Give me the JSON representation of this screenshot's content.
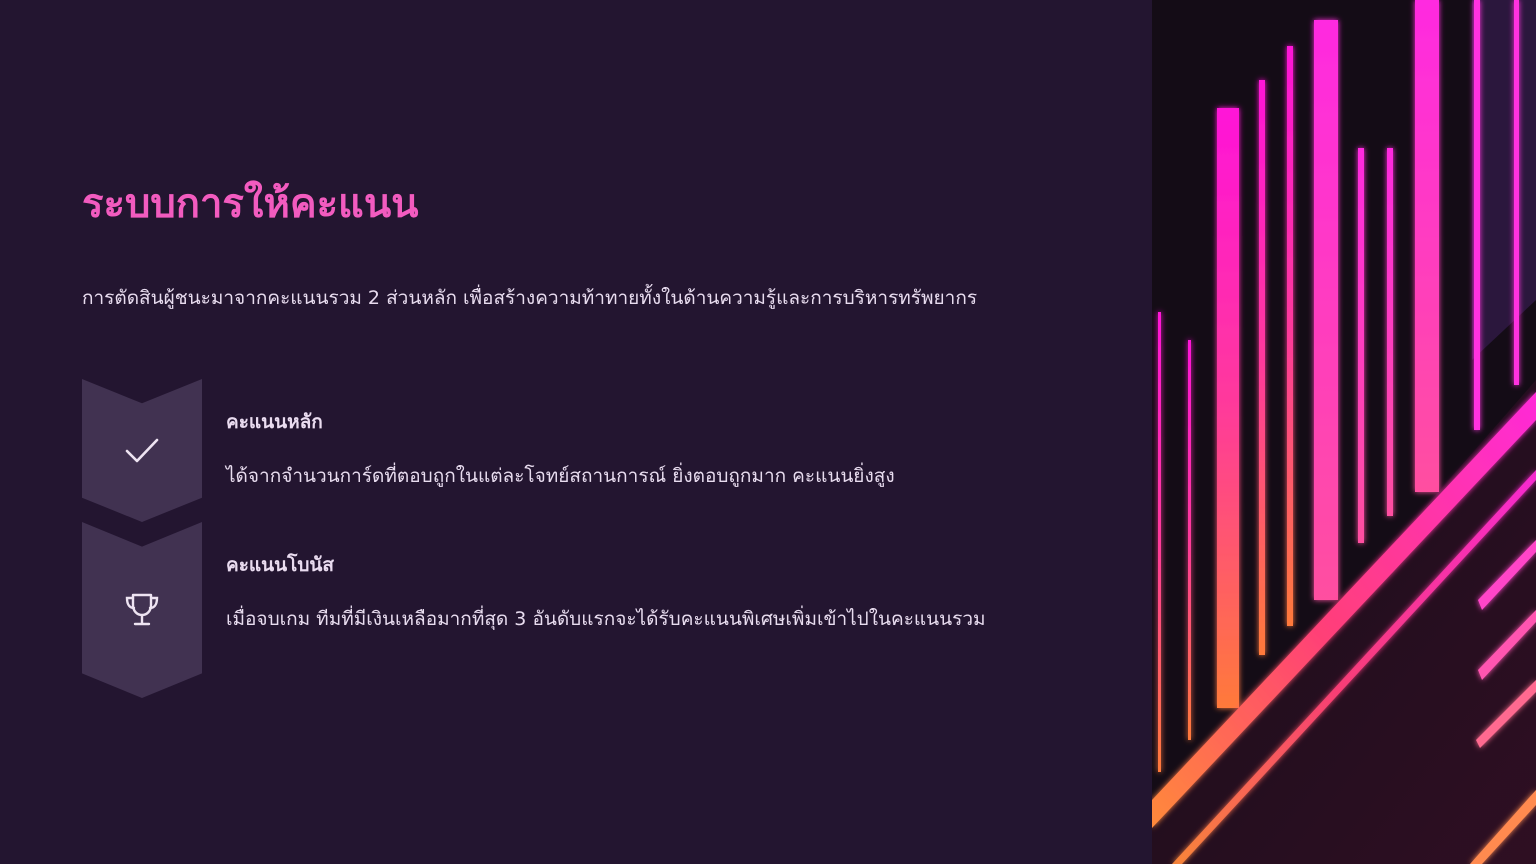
{
  "slide": {
    "title": "ระบบการให้คะแนน",
    "intro": "การตัดสินผู้ชนะมาจากคะแนนรวม 2 ส่วนหลัก เพื่อสร้างความท้าทายทั้งในด้านความรู้และการบริหารทรัพยากร",
    "items": [
      {
        "icon": "checkmark-icon",
        "heading": "คะแนนหลัก",
        "text": "ได้จากจำนวนการ์ดที่ตอบถูกในแต่ละโจทย์สถานการณ์ ยิ่งตอบถูกมาก คะแนนยิ่งสูง"
      },
      {
        "icon": "trophy-icon",
        "heading": "คะแนนโบนัส",
        "text": "เมื่อจบเกม ทีมที่มีเงินเหลือมากที่สุด 3 อันดับแรกจะได้รับคะแนนพิเศษเพิ่มเข้าไปในคะแนนรวม"
      }
    ]
  },
  "colors": {
    "background": "#231530",
    "title": "#f25bbf",
    "text": "#e8dcef",
    "chevron": "#413251",
    "neon_pink": "#ff1fd2",
    "neon_orange": "#ff7a3d"
  }
}
